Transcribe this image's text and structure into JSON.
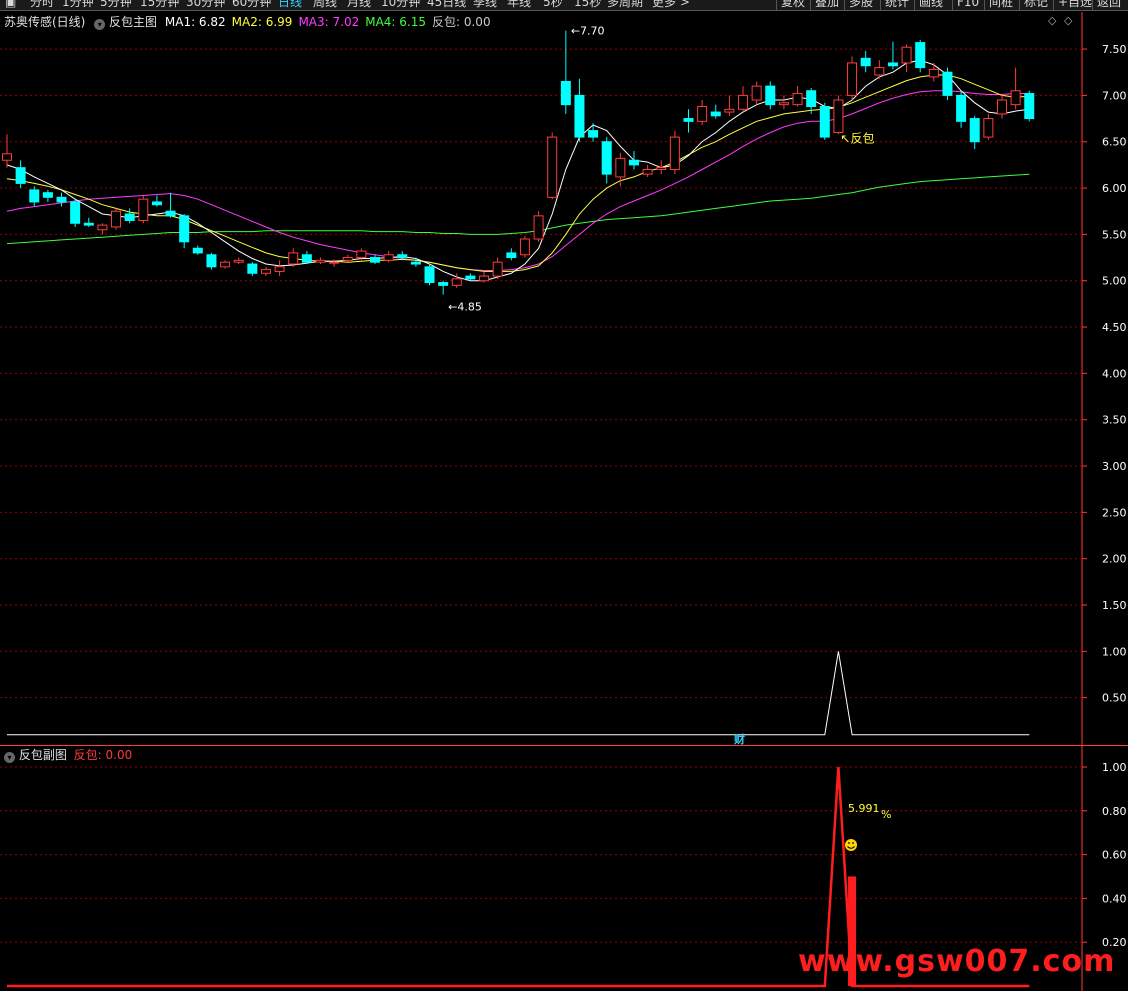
{
  "toolbar": {
    "periods": [
      "分时",
      "1分钟",
      "5分钟",
      "15分钟",
      "30分钟",
      "60分钟",
      "日线",
      "周线",
      "月线",
      "10分钟",
      "45日线",
      "季线",
      "年线",
      "5秒",
      "15秒",
      "多周期",
      "更多 >"
    ],
    "active_period": "日线",
    "right_buttons": [
      "复权",
      "叠加",
      "多股",
      "统计",
      "画线",
      "F10",
      "间桩",
      "标记",
      "+自选",
      "返回"
    ]
  },
  "main_header": {
    "stock": "苏奥传感(日线)",
    "indicator": "反包主图",
    "ma": [
      {
        "label": "MA1: 6.82",
        "color": "#ffffff"
      },
      {
        "label": "MA2: 6.99",
        "color": "#ffff3c"
      },
      {
        "label": "MA3: 7.02",
        "color": "#ff3cff"
      },
      {
        "label": "MA4: 6.15",
        "color": "#3cff3c"
      },
      {
        "label": "反包: 0.00",
        "color": "#c8c8c8"
      }
    ]
  },
  "sub_header": {
    "indicator": "反包副图",
    "value_label": "反包: 0.00"
  },
  "colors": {
    "up": "#ff3c3c",
    "down": "#00ffff",
    "ma1": "#ffffff",
    "ma2": "#ffff3c",
    "ma3": "#ff3cff",
    "ma4": "#3cff3c",
    "grid": "#9a0000",
    "axis": "#ff3c3c",
    "signal": "#ff1e1e",
    "label_yellow": "#ffff3c"
  },
  "chart_data": [
    {
      "type": "candlestick",
      "y_ticks": [
        "7.50",
        "7.00",
        "6.50",
        "6.00",
        "5.50",
        "5.00",
        "4.50",
        "4.00",
        "3.50",
        "3.00",
        "2.50",
        "2.00",
        "1.50",
        "1.00",
        "0.50"
      ],
      "ylim": [
        0.0,
        7.9
      ],
      "annotations": {
        "high": "7.70",
        "low": "4.85",
        "signal": "反包",
        "marker": "财"
      },
      "candles": [
        {
          "o": 6.3,
          "c": 6.37,
          "h": 6.58,
          "l": 6.22
        },
        {
          "o": 6.22,
          "c": 6.05,
          "h": 6.3,
          "l": 6.0
        },
        {
          "o": 5.98,
          "c": 5.85,
          "h": 6.02,
          "l": 5.8
        },
        {
          "o": 5.95,
          "c": 5.9,
          "h": 5.98,
          "l": 5.85
        },
        {
          "o": 5.9,
          "c": 5.85,
          "h": 5.95,
          "l": 5.8
        },
        {
          "o": 5.85,
          "c": 5.62,
          "h": 5.88,
          "l": 5.58
        },
        {
          "o": 5.62,
          "c": 5.6,
          "h": 5.68,
          "l": 5.58
        },
        {
          "o": 5.55,
          "c": 5.6,
          "h": 5.62,
          "l": 5.5
        },
        {
          "o": 5.58,
          "c": 5.75,
          "h": 5.78,
          "l": 5.55
        },
        {
          "o": 5.72,
          "c": 5.65,
          "h": 5.78,
          "l": 5.62
        },
        {
          "o": 5.65,
          "c": 5.88,
          "h": 5.92,
          "l": 5.62
        },
        {
          "o": 5.85,
          "c": 5.82,
          "h": 5.92,
          "l": 5.8
        },
        {
          "o": 5.75,
          "c": 5.7,
          "h": 5.95,
          "l": 5.68
        },
        {
          "o": 5.7,
          "c": 5.42,
          "h": 5.72,
          "l": 5.35
        },
        {
          "o": 5.35,
          "c": 5.3,
          "h": 5.38,
          "l": 5.28
        },
        {
          "o": 5.28,
          "c": 5.15,
          "h": 5.3,
          "l": 5.12
        },
        {
          "o": 5.15,
          "c": 5.2,
          "h": 5.22,
          "l": 5.13
        },
        {
          "o": 5.2,
          "c": 5.22,
          "h": 5.25,
          "l": 5.18
        },
        {
          "o": 5.18,
          "c": 5.08,
          "h": 5.2,
          "l": 5.05
        },
        {
          "o": 5.08,
          "c": 5.12,
          "h": 5.15,
          "l": 5.05
        },
        {
          "o": 5.1,
          "c": 5.15,
          "h": 5.22,
          "l": 5.05
        },
        {
          "o": 5.18,
          "c": 5.3,
          "h": 5.35,
          "l": 5.15
        },
        {
          "o": 5.28,
          "c": 5.2,
          "h": 5.32,
          "l": 5.18
        },
        {
          "o": 5.2,
          "c": 5.22,
          "h": 5.25,
          "l": 5.18
        },
        {
          "o": 5.2,
          "c": 5.2,
          "h": 5.23,
          "l": 5.15
        },
        {
          "o": 5.22,
          "c": 5.25,
          "h": 5.28,
          "l": 5.2
        },
        {
          "o": 5.25,
          "c": 5.32,
          "h": 5.35,
          "l": 5.22
        },
        {
          "o": 5.25,
          "c": 5.2,
          "h": 5.28,
          "l": 5.18
        },
        {
          "o": 5.22,
          "c": 5.28,
          "h": 5.32,
          "l": 5.2
        },
        {
          "o": 5.28,
          "c": 5.25,
          "h": 5.32,
          "l": 5.22
        },
        {
          "o": 5.2,
          "c": 5.18,
          "h": 5.25,
          "l": 5.15
        },
        {
          "o": 5.15,
          "c": 4.98,
          "h": 5.18,
          "l": 4.95
        },
        {
          "o": 4.98,
          "c": 4.95,
          "h": 5.0,
          "l": 4.85
        },
        {
          "o": 4.95,
          "c": 5.02,
          "h": 5.08,
          "l": 4.92
        },
        {
          "o": 5.05,
          "c": 5.02,
          "h": 5.08,
          "l": 5.0
        },
        {
          "o": 5.0,
          "c": 5.05,
          "h": 5.1,
          "l": 4.98
        },
        {
          "o": 5.05,
          "c": 5.2,
          "h": 5.25,
          "l": 5.02
        },
        {
          "o": 5.3,
          "c": 5.25,
          "h": 5.35,
          "l": 5.22
        },
        {
          "o": 5.28,
          "c": 5.45,
          "h": 5.48,
          "l": 5.25
        },
        {
          "o": 5.45,
          "c": 5.7,
          "h": 5.75,
          "l": 5.42
        },
        {
          "o": 5.9,
          "c": 6.55,
          "h": 6.6,
          "l": 5.88
        },
        {
          "o": 7.15,
          "c": 6.9,
          "h": 7.7,
          "l": 6.8
        },
        {
          "o": 7.0,
          "c": 6.55,
          "h": 7.18,
          "l": 6.5
        },
        {
          "o": 6.62,
          "c": 6.55,
          "h": 6.7,
          "l": 6.5
        },
        {
          "o": 6.5,
          "c": 6.15,
          "h": 6.55,
          "l": 6.05
        },
        {
          "o": 6.12,
          "c": 6.32,
          "h": 6.38,
          "l": 6.02
        },
        {
          "o": 6.3,
          "c": 6.25,
          "h": 6.4,
          "l": 6.2
        },
        {
          "o": 6.15,
          "c": 6.2,
          "h": 6.25,
          "l": 6.12
        },
        {
          "o": 6.2,
          "c": 6.22,
          "h": 6.3,
          "l": 6.15
        },
        {
          "o": 6.2,
          "c": 6.55,
          "h": 6.62,
          "l": 6.15
        },
        {
          "o": 6.75,
          "c": 6.72,
          "h": 6.85,
          "l": 6.6
        },
        {
          "o": 6.72,
          "c": 6.88,
          "h": 6.95,
          "l": 6.68
        },
        {
          "o": 6.82,
          "c": 6.78,
          "h": 6.9,
          "l": 6.75
        },
        {
          "o": 6.82,
          "c": 6.85,
          "h": 7.0,
          "l": 6.78
        },
        {
          "o": 6.85,
          "c": 7.0,
          "h": 7.1,
          "l": 6.82
        },
        {
          "o": 6.95,
          "c": 7.1,
          "h": 7.15,
          "l": 6.9
        },
        {
          "o": 7.1,
          "c": 6.9,
          "h": 7.15,
          "l": 6.85
        },
        {
          "o": 6.9,
          "c": 6.92,
          "h": 7.0,
          "l": 6.85
        },
        {
          "o": 6.9,
          "c": 7.02,
          "h": 7.1,
          "l": 6.88
        },
        {
          "o": 7.05,
          "c": 6.88,
          "h": 7.08,
          "l": 6.8
        },
        {
          "o": 6.88,
          "c": 6.55,
          "h": 6.92,
          "l": 6.52
        },
        {
          "o": 6.6,
          "c": 6.95,
          "h": 7.0,
          "l": 6.58
        },
        {
          "o": 7.0,
          "c": 7.35,
          "h": 7.42,
          "l": 6.95
        },
        {
          "o": 7.4,
          "c": 7.32,
          "h": 7.48,
          "l": 7.25
        },
        {
          "o": 7.22,
          "c": 7.3,
          "h": 7.38,
          "l": 7.18
        },
        {
          "o": 7.35,
          "c": 7.32,
          "h": 7.58,
          "l": 7.28
        },
        {
          "o": 7.35,
          "c": 7.52,
          "h": 7.55,
          "l": 7.25
        },
        {
          "o": 7.57,
          "c": 7.3,
          "h": 7.6,
          "l": 7.25
        },
        {
          "o": 7.2,
          "c": 7.28,
          "h": 7.35,
          "l": 7.15
        },
        {
          "o": 7.25,
          "c": 7.0,
          "h": 7.3,
          "l": 6.95
        },
        {
          "o": 7.0,
          "c": 6.72,
          "h": 7.05,
          "l": 6.65
        },
        {
          "o": 6.75,
          "c": 6.5,
          "h": 6.78,
          "l": 6.42
        },
        {
          "o": 6.55,
          "c": 6.75,
          "h": 6.8,
          "l": 6.52
        },
        {
          "o": 6.8,
          "c": 6.95,
          "h": 7.02,
          "l": 6.75
        },
        {
          "o": 6.9,
          "c": 7.05,
          "h": 7.3,
          "l": 6.85
        },
        {
          "o": 7.02,
          "c": 6.75,
          "h": 7.05,
          "l": 6.72
        }
      ],
      "ma1": [
        6.25,
        6.2,
        6.12,
        6.05,
        5.98,
        5.88,
        5.8,
        5.72,
        5.7,
        5.68,
        5.7,
        5.72,
        5.74,
        5.7,
        5.62,
        5.52,
        5.42,
        5.32,
        5.24,
        5.18,
        5.16,
        5.17,
        5.19,
        5.21,
        5.21,
        5.22,
        5.24,
        5.24,
        5.25,
        5.26,
        5.24,
        5.18,
        5.1,
        5.04,
        5.0,
        5.0,
        5.04,
        5.08,
        5.18,
        5.35,
        5.72,
        6.2,
        6.55,
        6.68,
        6.62,
        6.45,
        6.3,
        6.28,
        6.22,
        6.25,
        6.35,
        6.5,
        6.6,
        6.72,
        6.82,
        6.9,
        6.95,
        6.95,
        6.98,
        6.96,
        6.88,
        6.86,
        6.95,
        7.1,
        7.2,
        7.25,
        7.35,
        7.38,
        7.33,
        7.22,
        7.05,
        6.92,
        6.82,
        6.8,
        6.83,
        6.85
      ],
      "ma2": [
        6.1,
        6.08,
        6.05,
        6.02,
        5.98,
        5.93,
        5.88,
        5.82,
        5.78,
        5.74,
        5.72,
        5.7,
        5.7,
        5.66,
        5.6,
        5.54,
        5.48,
        5.42,
        5.36,
        5.3,
        5.26,
        5.24,
        5.22,
        5.21,
        5.21,
        5.2,
        5.21,
        5.22,
        5.22,
        5.23,
        5.22,
        5.2,
        5.17,
        5.14,
        5.12,
        5.1,
        5.1,
        5.1,
        5.12,
        5.16,
        5.3,
        5.5,
        5.72,
        5.88,
        6.0,
        6.08,
        6.12,
        6.18,
        6.22,
        6.28,
        6.36,
        6.44,
        6.5,
        6.58,
        6.65,
        6.72,
        6.76,
        6.8,
        6.82,
        6.84,
        6.85,
        6.87,
        6.92,
        6.98,
        7.04,
        7.1,
        7.16,
        7.2,
        7.22,
        7.22,
        7.18,
        7.12,
        7.06,
        7.0,
        6.98,
        6.99
      ],
      "ma3": [
        5.75,
        5.78,
        5.8,
        5.82,
        5.84,
        5.86,
        5.88,
        5.89,
        5.9,
        5.91,
        5.92,
        5.93,
        5.94,
        5.92,
        5.88,
        5.82,
        5.76,
        5.7,
        5.64,
        5.58,
        5.52,
        5.47,
        5.43,
        5.39,
        5.36,
        5.33,
        5.3,
        5.28,
        5.26,
        5.24,
        5.22,
        5.2,
        5.17,
        5.14,
        5.12,
        5.11,
        5.11,
        5.12,
        5.14,
        5.18,
        5.26,
        5.38,
        5.5,
        5.62,
        5.72,
        5.8,
        5.86,
        5.92,
        5.98,
        6.05,
        6.12,
        6.2,
        6.28,
        6.36,
        6.45,
        6.53,
        6.6,
        6.66,
        6.7,
        6.72,
        6.72,
        6.75,
        6.8,
        6.86,
        6.92,
        6.97,
        7.01,
        7.04,
        7.05,
        7.05,
        7.04,
        7.02,
        7.01,
        7.01,
        7.02,
        7.02
      ],
      "ma4": [
        5.4,
        5.41,
        5.42,
        5.43,
        5.44,
        5.45,
        5.46,
        5.47,
        5.48,
        5.49,
        5.5,
        5.51,
        5.52,
        5.52,
        5.52,
        5.53,
        5.53,
        5.53,
        5.53,
        5.54,
        5.54,
        5.54,
        5.54,
        5.54,
        5.54,
        5.54,
        5.54,
        5.53,
        5.53,
        5.53,
        5.52,
        5.52,
        5.51,
        5.51,
        5.5,
        5.5,
        5.5,
        5.51,
        5.52,
        5.54,
        5.57,
        5.6,
        5.62,
        5.64,
        5.66,
        5.67,
        5.68,
        5.69,
        5.7,
        5.72,
        5.74,
        5.76,
        5.78,
        5.8,
        5.82,
        5.84,
        5.86,
        5.87,
        5.88,
        5.89,
        5.91,
        5.93,
        5.95,
        5.98,
        6.01,
        6.03,
        6.05,
        6.07,
        6.08,
        6.09,
        6.1,
        6.11,
        6.12,
        6.13,
        6.14,
        6.15
      ],
      "signal_line": [
        0,
        0,
        0,
        0,
        0,
        0,
        0,
        0,
        0,
        0,
        0,
        0,
        0,
        0,
        0,
        0,
        0,
        0,
        0,
        0,
        0,
        0,
        0,
        0,
        0,
        0,
        0,
        0,
        0,
        0,
        0,
        0,
        0,
        0,
        0,
        0,
        0,
        0,
        0,
        0,
        0,
        0,
        0,
        0,
        0,
        0,
        0,
        0,
        0,
        0,
        0,
        0,
        0,
        0,
        0,
        0,
        0,
        0,
        0,
        0,
        0,
        1,
        0,
        0,
        0,
        0,
        0,
        0,
        0,
        0,
        0,
        0,
        0,
        0,
        0,
        0
      ]
    },
    {
      "type": "line",
      "y_ticks": [
        "1.00",
        "0.80",
        "0.60",
        "0.40",
        "0.20"
      ],
      "ylim": [
        0,
        1.0
      ],
      "series_values": [
        0,
        0,
        0,
        0,
        0,
        0,
        0,
        0,
        0,
        0,
        0,
        0,
        0,
        0,
        0,
        0,
        0,
        0,
        0,
        0,
        0,
        0,
        0,
        0,
        0,
        0,
        0,
        0,
        0,
        0,
        0,
        0,
        0,
        0,
        0,
        0,
        0,
        0,
        0,
        0,
        0,
        0,
        0,
        0,
        0,
        0,
        0,
        0,
        0,
        0,
        0,
        0,
        0,
        0,
        0,
        0,
        0,
        0,
        0,
        0,
        0,
        1,
        0,
        0,
        0,
        0,
        0,
        0,
        0,
        0,
        0,
        0,
        0,
        0,
        0,
        0
      ],
      "bar": {
        "index": 62,
        "value": 0.5
      },
      "annotation": {
        "value": "5.991",
        "unit": "%"
      }
    }
  ],
  "watermark": "www.gsw007.com"
}
